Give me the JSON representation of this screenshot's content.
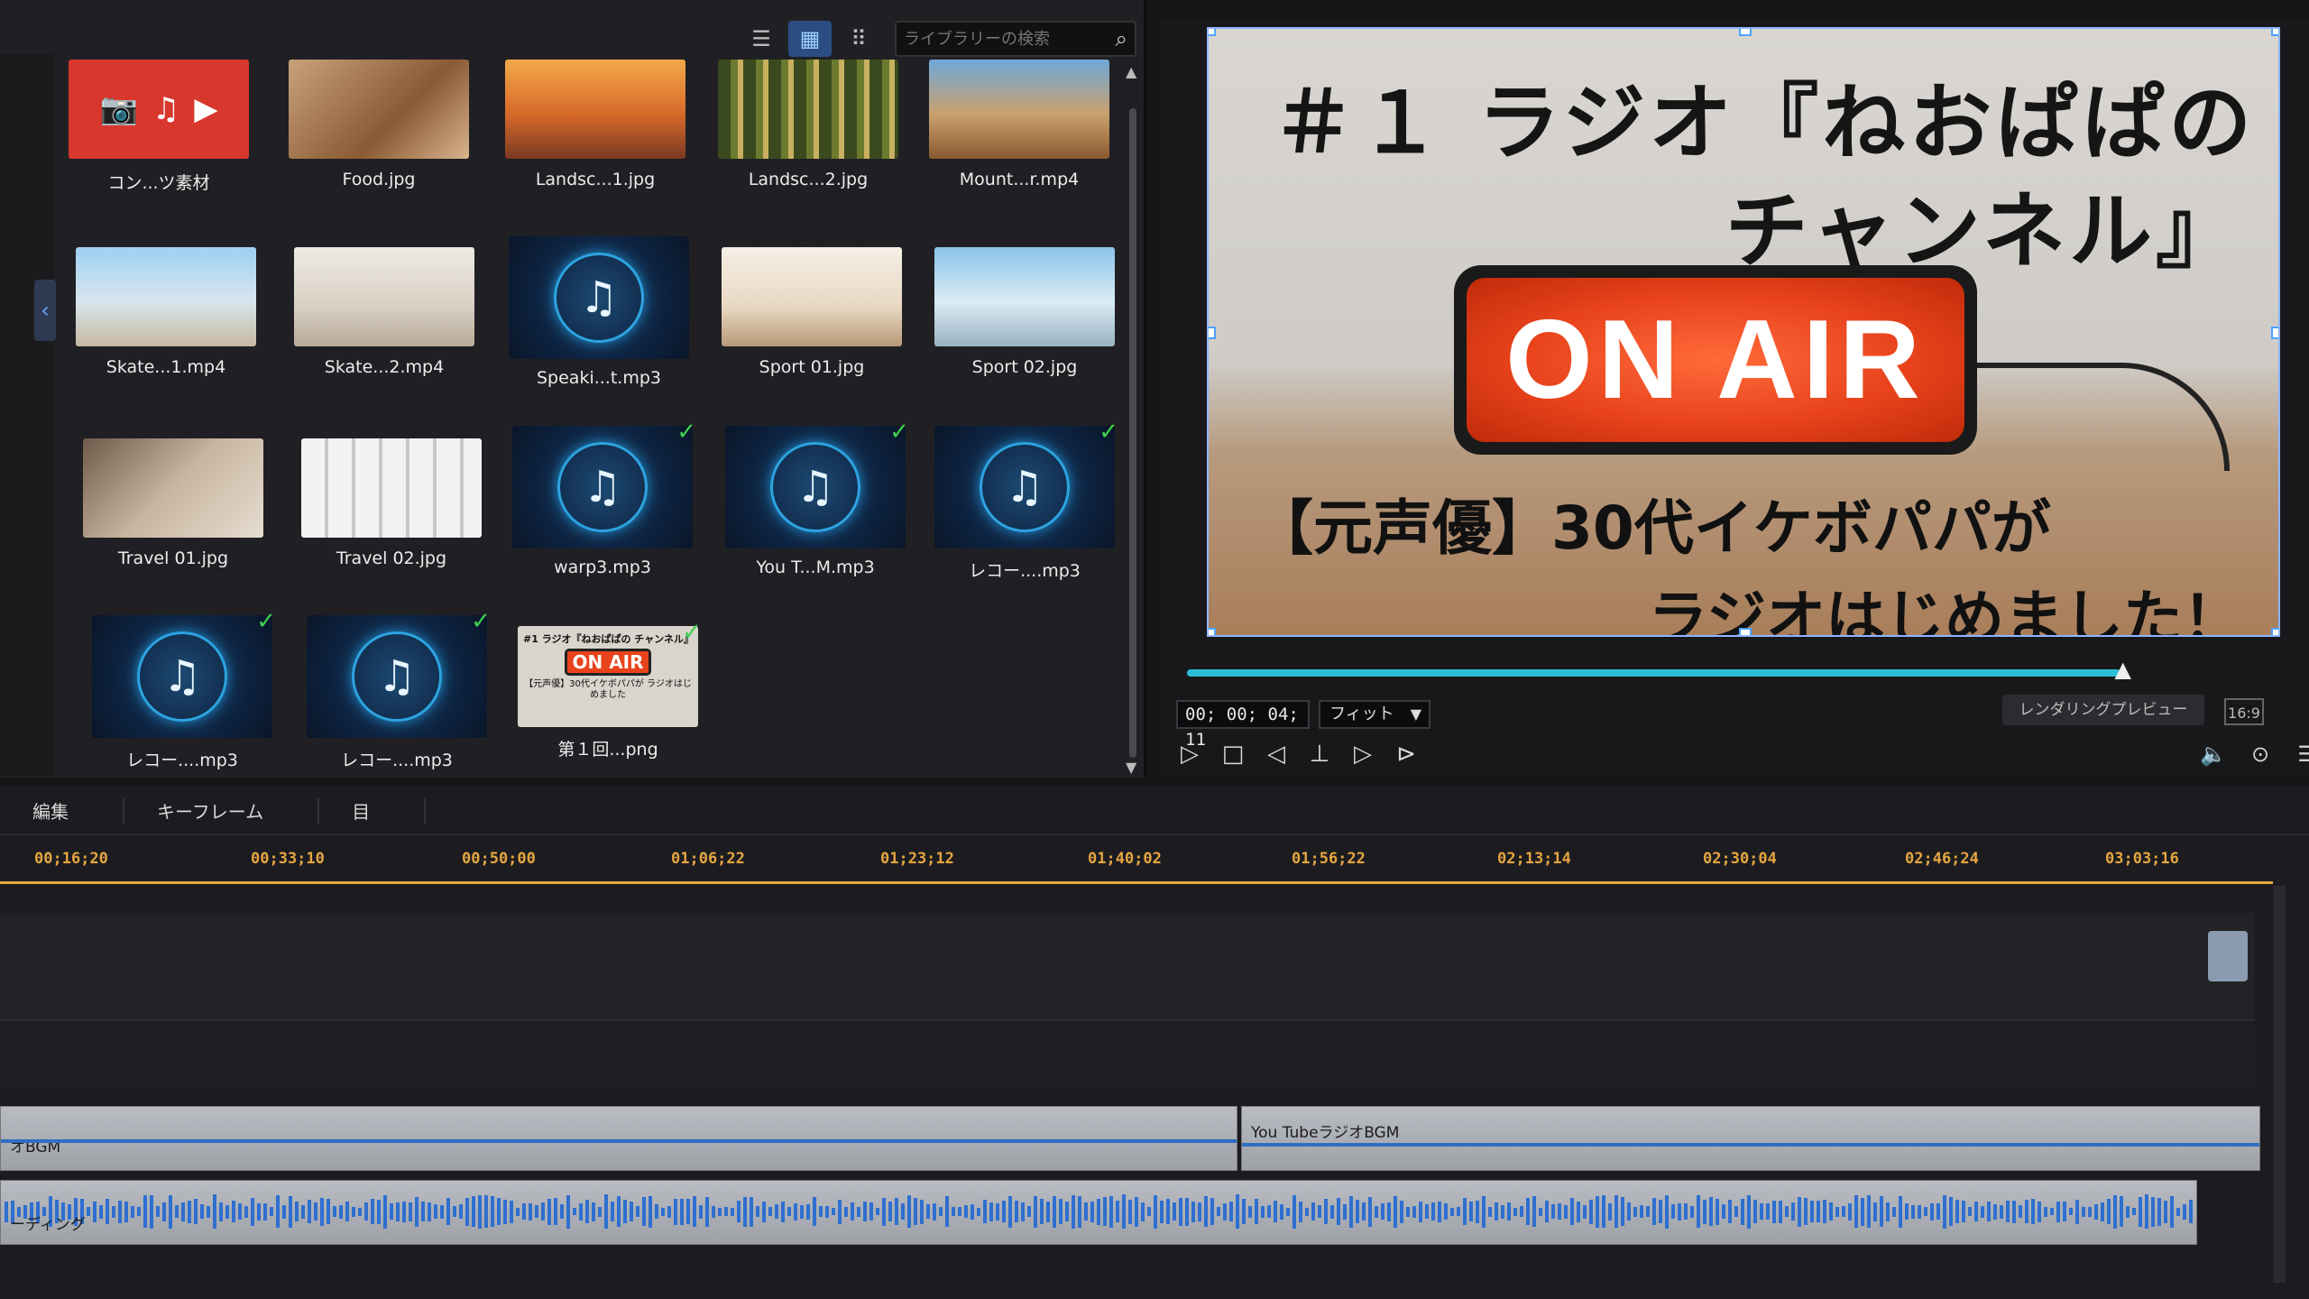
{
  "library": {
    "search": {
      "placeholder": "ライブラリーの検索"
    },
    "items": [
      {
        "name": "コン...ツ素材",
        "type": "content"
      },
      {
        "name": "Food.jpg",
        "type": "image"
      },
      {
        "name": "Landsc...1.jpg",
        "type": "image"
      },
      {
        "name": "Landsc...2.jpg",
        "type": "image"
      },
      {
        "name": "Mount...r.mp4",
        "type": "video"
      },
      {
        "name": "Skate...1.mp4",
        "type": "video"
      },
      {
        "name": "Skate...2.mp4",
        "type": "video"
      },
      {
        "name": "Speaki...t.mp3",
        "type": "audio"
      },
      {
        "name": "Sport 01.jpg",
        "type": "image"
      },
      {
        "name": "Sport 02.jpg",
        "type": "image"
      },
      {
        "name": "Travel 01.jpg",
        "type": "image"
      },
      {
        "name": "Travel 02.jpg",
        "type": "image"
      },
      {
        "name": "warp3.mp3",
        "type": "audio",
        "checked": true
      },
      {
        "name": "You T...M.mp3",
        "type": "audio",
        "checked": true
      },
      {
        "name": "レコー....mp3",
        "type": "audio",
        "checked": true
      },
      {
        "name": "レコー....mp3",
        "type": "audio",
        "checked": true
      },
      {
        "name": "レコー....mp3",
        "type": "audio",
        "checked": true
      },
      {
        "name": "第１回...png",
        "type": "image",
        "checked": true
      }
    ],
    "icons": {
      "content": [
        "camera-icon",
        "music-note-icon",
        "play-icon"
      ],
      "music": "music-note-icon"
    },
    "check_color": "#3cd24e"
  },
  "preview": {
    "title_line1": "＃１ ラジオ『ねおぱぱの",
    "title_line2": "チャンネル』",
    "onair": "ON AIR",
    "sub_line1": "【元声優】30代イケボパパが",
    "sub_line2": "ラジオはじめました！",
    "timecode": "00; 00; 04; 11",
    "fit": "フィット",
    "render": "レンダリングプレビュー",
    "aspect": "16:9",
    "progress": 0.9,
    "thumb_title": "#1 ラジオ『ねおぱぱの チャンネル』",
    "thumb_onair": "ON AIR",
    "thumb_sub": "【元声優】30代イケボパパが ラジオはじめました"
  },
  "timeline": {
    "tabs": [
      "編集",
      "キーフレーム",
      "目"
    ],
    "ruler": [
      "00;16;20",
      "00;33;10",
      "00;50;00",
      "01;06;22",
      "01;23;12",
      "01;40;02",
      "01;56;22",
      "02;13;14",
      "02;30;04",
      "02;46;24",
      "03;03;16"
    ],
    "clips": {
      "bgm_left": "オBGM",
      "bgm_right": "You TubeラジオBGM",
      "voice": "ーディング"
    },
    "ruler_color": "#e6a640",
    "wave_color": "#2f6fc4"
  }
}
